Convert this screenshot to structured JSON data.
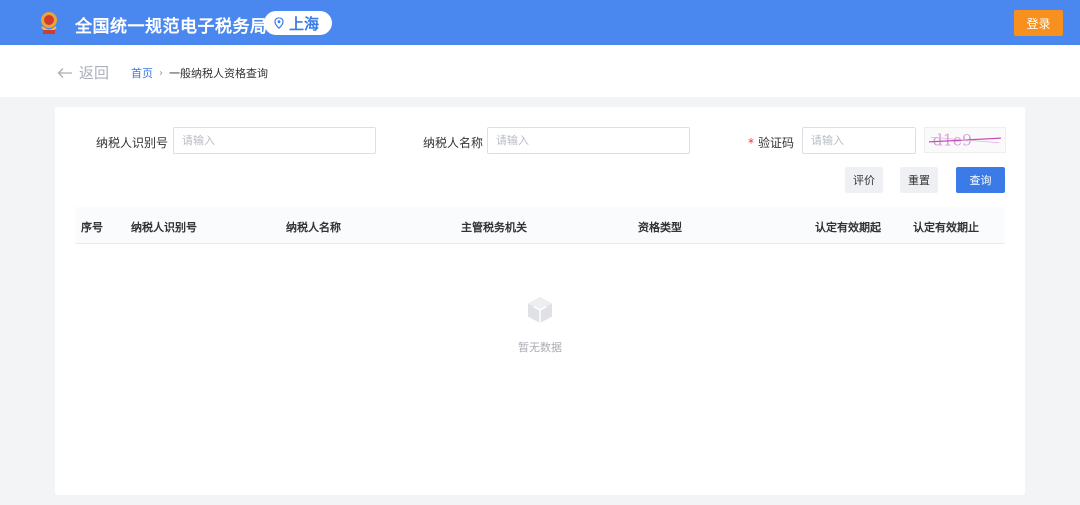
{
  "header": {
    "title": "全国统一规范电子税务局",
    "city": "上海",
    "login_label": "登录",
    "colors": {
      "bar": "#4a87ee",
      "login": "#f7901e"
    }
  },
  "nav": {
    "back_label": "返回",
    "breadcrumb_home": "首页",
    "breadcrumb_sep": "›",
    "breadcrumb_current": "一般纳税人资格查询"
  },
  "form": {
    "taxpayer_id_label": "纳税人识别号",
    "taxpayer_id_placeholder": "请输入",
    "taxpayer_name_label": "纳税人名称",
    "taxpayer_name_placeholder": "请输入",
    "captcha_label": "验证码",
    "captcha_required_mark": "*",
    "captcha_placeholder": "请输入",
    "captcha_text": "d1e9"
  },
  "actions": {
    "evaluate_label": "评价",
    "reset_label": "重置",
    "search_label": "查询"
  },
  "table": {
    "columns": [
      "序号",
      "纳税人识别号",
      "纳税人名称",
      "主管税务机关",
      "资格类型",
      "认定有效期起",
      "认定有效期止"
    ],
    "rows": [],
    "empty_text": "暂无数据"
  }
}
